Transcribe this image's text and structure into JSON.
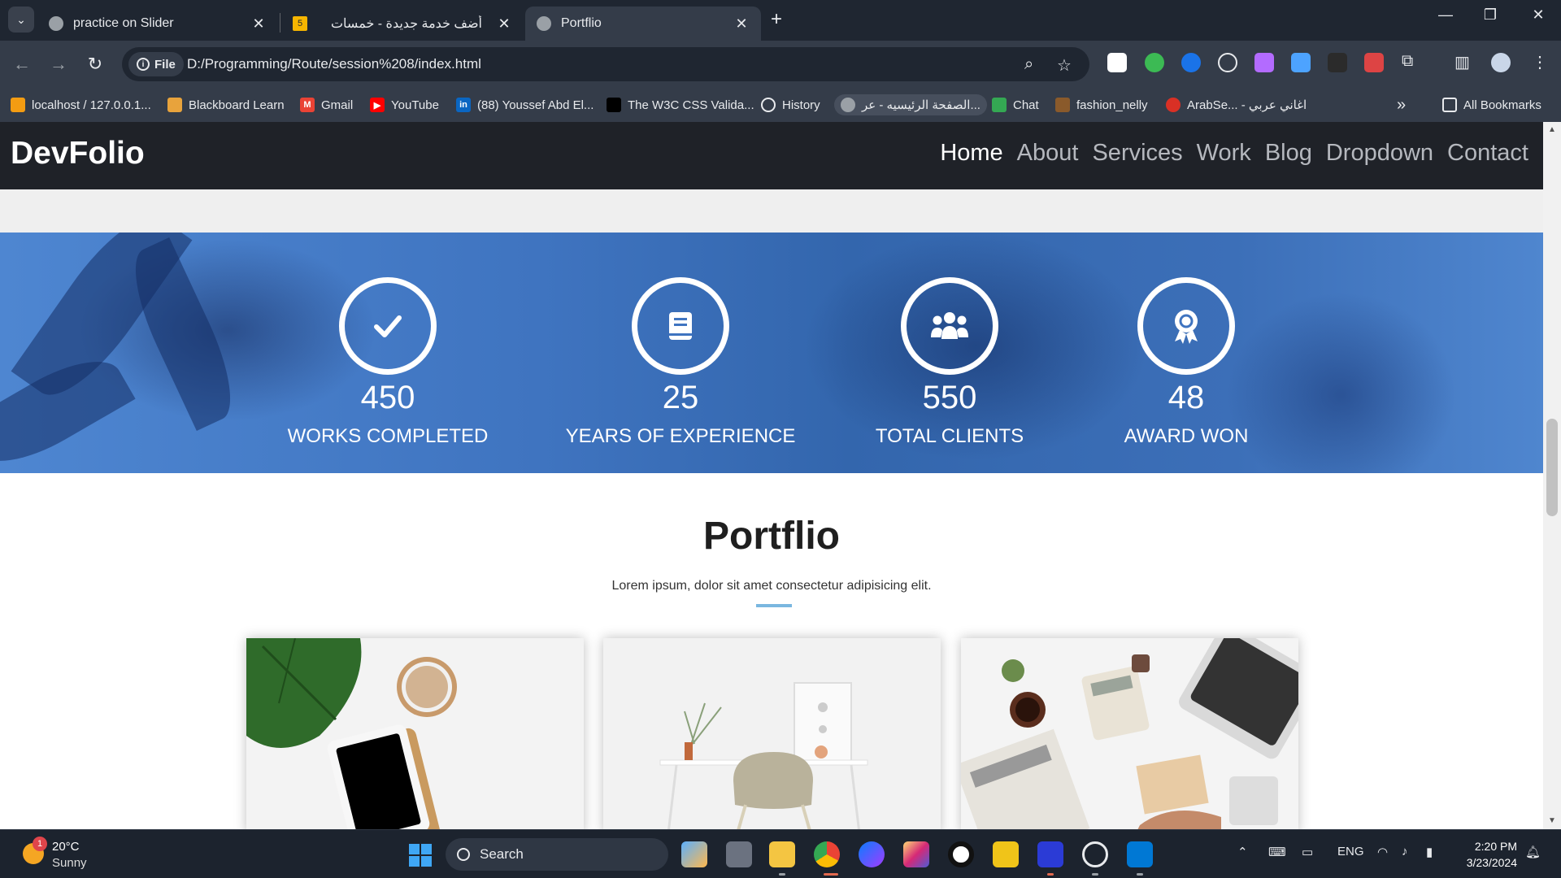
{
  "tabs": [
    {
      "title": "practice on Slider",
      "favicon": "globe-icon"
    },
    {
      "title": "أضف خدمة جديدة - خمسات",
      "favicon": "khamsat-icon",
      "favicon_text": "5"
    },
    {
      "title": "Portflio",
      "favicon": "globe-icon",
      "active": true
    }
  ],
  "omnibox": {
    "chip": "File",
    "url": "D:/Programming/Route/session%208/index.html"
  },
  "bookmarks": [
    {
      "label": "localhost / 127.0.0.1...",
      "icon": "phpmyadmin-icon"
    },
    {
      "label": "Blackboard Learn",
      "icon": "blackboard-icon"
    },
    {
      "label": "Gmail",
      "icon": "gmail-icon"
    },
    {
      "label": "YouTube",
      "icon": "youtube-icon"
    },
    {
      "label": "(88) Youssef Abd El...",
      "icon": "linkedin-icon"
    },
    {
      "label": "The W3C CSS Valida...",
      "icon": "w3c-icon"
    },
    {
      "label": "History",
      "icon": "history-icon"
    },
    {
      "label": "الصفحة الرئيسيه - عر...",
      "icon": "site-icon"
    },
    {
      "label": "Chat",
      "icon": "chat-icon"
    },
    {
      "label": "fashion_nelly",
      "icon": "fashion-icon"
    },
    {
      "label": "ArabSe... - اغاني عربي",
      "icon": "arabseed-icon"
    }
  ],
  "all_bookmarks": "All Bookmarks",
  "site": {
    "brand": "DevFolio",
    "nav": [
      "Home",
      "About",
      "Services",
      "Work",
      "Blog",
      "Dropdown",
      "Contact"
    ],
    "counters": [
      {
        "number": "450",
        "label": "WORKS COMPLETED",
        "icon": "check-icon"
      },
      {
        "number": "25",
        "label": "YEARS OF EXPERIENCE",
        "icon": "book-icon"
      },
      {
        "number": "550",
        "label": "TOTAL CLIENTS",
        "icon": "users-icon"
      },
      {
        "number": "48",
        "label": "AWARD WON",
        "icon": "award-icon"
      }
    ],
    "portfolio": {
      "title": "Portflio",
      "subtitle": "Lorem ipsum, dolor sit amet consectetur adipisicing elit."
    }
  },
  "taskbar": {
    "weather": {
      "temp": "20°C",
      "condition": "Sunny",
      "badge": "1"
    },
    "search": "Search",
    "language": "ENG",
    "time": "2:20 PM",
    "date": "3/23/2024"
  }
}
